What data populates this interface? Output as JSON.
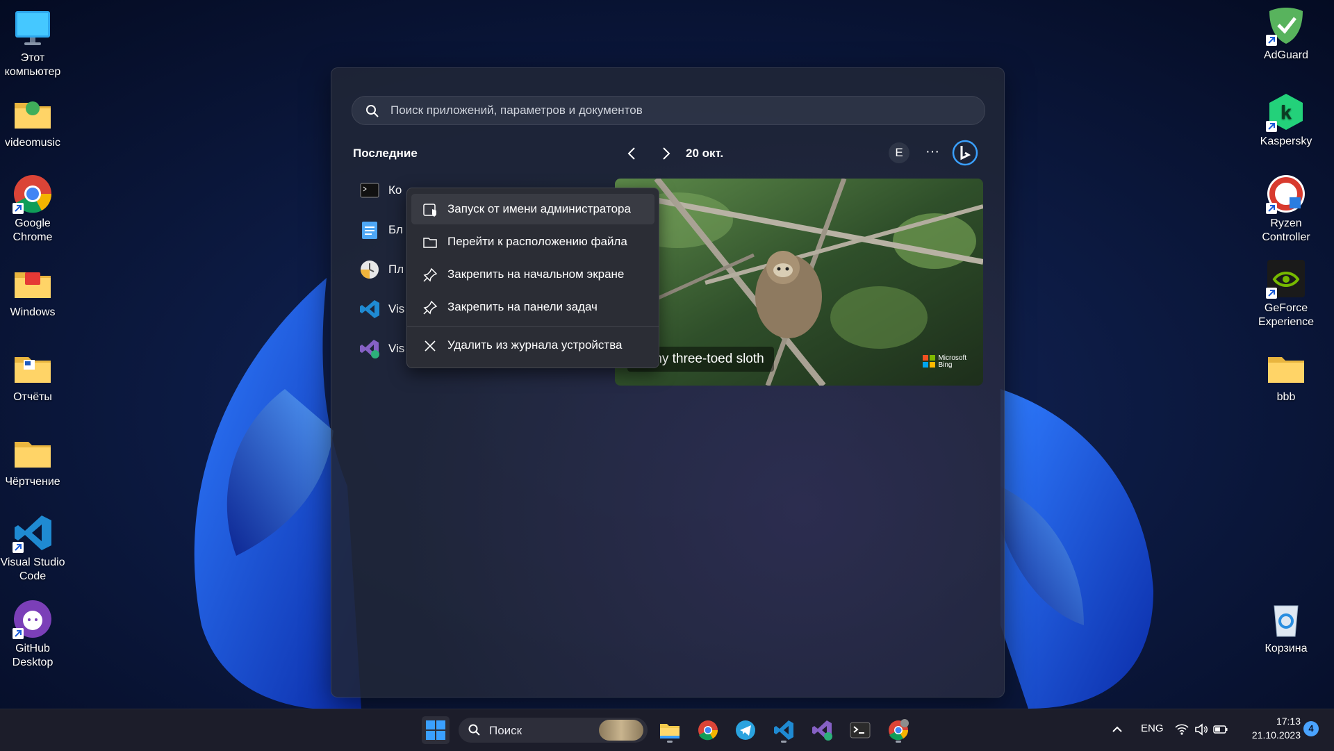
{
  "desktop": {
    "left_icons": [
      {
        "label": "Этот компьютер",
        "icon": "monitor-icon"
      },
      {
        "label": "videomusic",
        "icon": "folder-icon"
      },
      {
        "label": "Google Chrome",
        "icon": "chrome-icon"
      },
      {
        "label": "Windows",
        "icon": "folder-icon"
      },
      {
        "label": "Отчёты",
        "icon": "folder-icon"
      },
      {
        "label": "Чёртчение",
        "icon": "folder-icon"
      },
      {
        "label": "Visual Studio Code",
        "icon": "vscode-icon"
      },
      {
        "label": "GitHub Desktop",
        "icon": "github-icon"
      }
    ],
    "right_icons": [
      {
        "label": "AdGuard",
        "icon": "adguard-icon"
      },
      {
        "label": "Kaspersky",
        "icon": "kaspersky-icon"
      },
      {
        "label": "Ryzen Controller",
        "icon": "ryzen-controller-icon"
      },
      {
        "label": "GeForce Experience",
        "icon": "geforce-icon"
      },
      {
        "label": "bbb",
        "icon": "folder-icon"
      },
      {
        "label": "Корзина",
        "icon": "recycle-bin-icon"
      }
    ]
  },
  "start_menu": {
    "search_placeholder": "Поиск приложений, параметров и документов",
    "recent_title": "Последние",
    "date_label": "20 окт.",
    "account_initial": "E",
    "more_label": "···",
    "recent_items": [
      {
        "label": "Ко",
        "icon": "terminal-icon"
      },
      {
        "label": "Бл",
        "icon": "notepad-icon"
      },
      {
        "label": "Пл",
        "icon": "clock-icon"
      },
      {
        "label": "Vis",
        "icon": "vscode-icon"
      },
      {
        "label": "Vis",
        "icon": "visual-studio-icon"
      }
    ],
    "bing_card": {
      "caption": "ygmy three-toed sloth",
      "brand_line1": "Microsoft",
      "brand_line2": "Bing"
    }
  },
  "context_menu": {
    "items": [
      {
        "label": "Запуск от имени администратора",
        "icon": "admin-shield-icon"
      },
      {
        "label": "Перейти к расположению файла",
        "icon": "folder-open-icon"
      },
      {
        "label": "Закрепить на начальном экране",
        "icon": "pin-icon"
      },
      {
        "label": "Закрепить на панели задач",
        "icon": "pin-icon"
      },
      {
        "label": "Удалить из журнала устройства",
        "icon": "close-icon"
      }
    ]
  },
  "taskbar": {
    "search_label": "Поиск",
    "apps": [
      "file-explorer-icon",
      "chrome-icon",
      "telegram-icon",
      "vscode-icon",
      "visual-studio-icon",
      "terminal-icon",
      "chrome-canary-icon"
    ],
    "tray": {
      "lang": "ENG",
      "time": "17:13",
      "date": "21.10.2023",
      "notifications": "4"
    }
  }
}
